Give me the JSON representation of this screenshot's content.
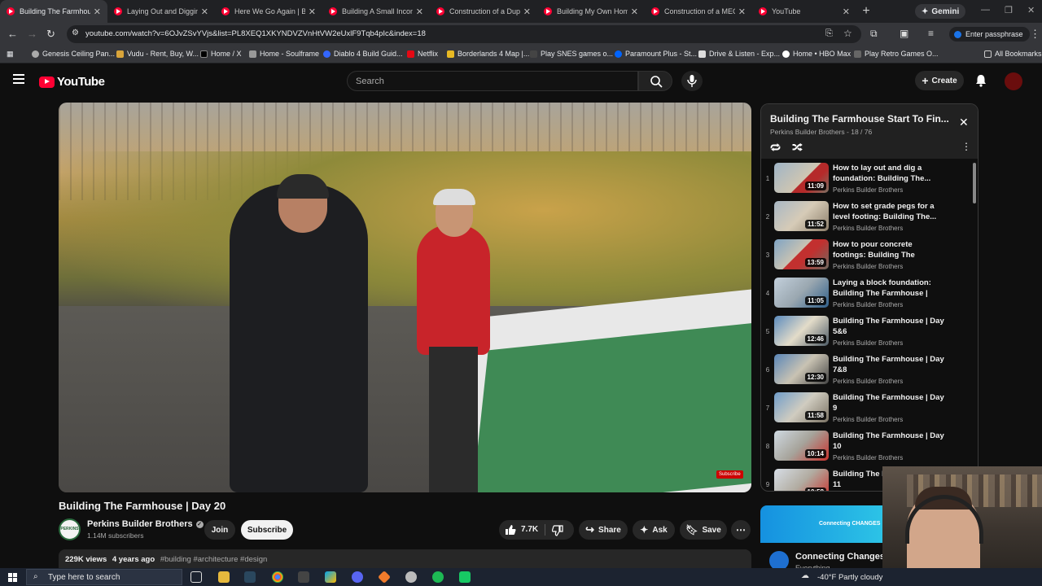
{
  "browser": {
    "tabs": [
      {
        "label": "Building The Farmhouse",
        "active": true
      },
      {
        "label": "Laying Out and Digging",
        "active": false
      },
      {
        "label": "Here We Go Again | Buil",
        "active": false
      },
      {
        "label": "Building A Small Income",
        "active": false
      },
      {
        "label": "Construction of a Duple",
        "active": false
      },
      {
        "label": "Building My Own Home",
        "active": false
      },
      {
        "label": "Construction of a MEGA",
        "active": false
      },
      {
        "label": "YouTube",
        "active": false
      }
    ],
    "gemini_label": "Gemini",
    "url": "youtube.com/watch?v=6OJvZSvYVjs&list=PL8XEQ1XKYNDVZVnHtVW2eUxlF9Tqb4pIc&index=18",
    "passphrase_label": "Enter passphrase",
    "bookmarks": [
      "Genesis Ceiling Pan...",
      "Vudu - Rent, Buy, W...",
      "Home / X",
      "Home - Soulframe",
      "Diablo 4 Build Guid...",
      "Netflix",
      "Borderlands 4 Map |...",
      "Play SNES games o...",
      "Paramount Plus - St...",
      "Drive & Listen - Exp...",
      "Home • HBO Max",
      "Play Retro Games O..."
    ],
    "all_bookmarks_label": "All Bookmarks"
  },
  "youtube": {
    "logo_text": "YouTube",
    "search_placeholder": "Search",
    "create_label": "Create",
    "accent": "#ff0033"
  },
  "video": {
    "title": "Building The Farmhouse | Day 20",
    "watermark_text": "Subscribe",
    "channel_name": "Perkins Builder Brothers",
    "channel_avatar_text": "PERKINS",
    "subscribers": "1.14M subscribers",
    "join_label": "Join",
    "subscribe_label": "Subscribe",
    "likes": "7.7K",
    "share_label": "Share",
    "ask_label": "Ask",
    "save_label": "Save",
    "views": "229K views",
    "age": "4 years ago",
    "hashtags": "#building #architecture #design"
  },
  "playlist": {
    "title": "Building The Farmhouse Start To Fin...",
    "owner": "Perkins Builder Brothers",
    "position": "18 / 76",
    "items": [
      {
        "num": "1",
        "title": "How to lay out and dig a foundation: Building The...",
        "channel": "Perkins Builder Brothers",
        "duration": "11:09"
      },
      {
        "num": "2",
        "title": "How to set grade pegs for a level footing: Building The...",
        "channel": "Perkins Builder Brothers",
        "duration": "11:52"
      },
      {
        "num": "3",
        "title": "How to pour concrete footings: Building The Farmhouse | Day...",
        "channel": "Perkins Builder Brothers",
        "duration": "13:59"
      },
      {
        "num": "4",
        "title": "Laying a block foundation: Building The Farmhouse | Day...",
        "channel": "Perkins Builder Brothers",
        "duration": "11:05"
      },
      {
        "num": "5",
        "title": "Building The Farmhouse | Day 5&6",
        "channel": "Perkins Builder Brothers",
        "duration": "12:46"
      },
      {
        "num": "6",
        "title": "Building The Farmhouse | Day 7&8",
        "channel": "Perkins Builder Brothers",
        "duration": "12:30"
      },
      {
        "num": "7",
        "title": "Building The Farmhouse | Day 9",
        "channel": "Perkins Builder Brothers",
        "duration": "11:58"
      },
      {
        "num": "8",
        "title": "Building The Farmhouse | Day 10",
        "channel": "Perkins Builder Brothers",
        "duration": "10:14"
      },
      {
        "num": "9",
        "title": "Building The Farmhouse | Day 11",
        "channel": "Perkins Builder Brothers",
        "duration": "10:58"
      }
    ]
  },
  "ad": {
    "card_text": "Connecting CHANGES",
    "title": "Connecting Changes",
    "subtitle": "Everything..."
  },
  "taskbar": {
    "search_placeholder": "Type here to search",
    "weather": "-40°F  Partly cloudy"
  }
}
